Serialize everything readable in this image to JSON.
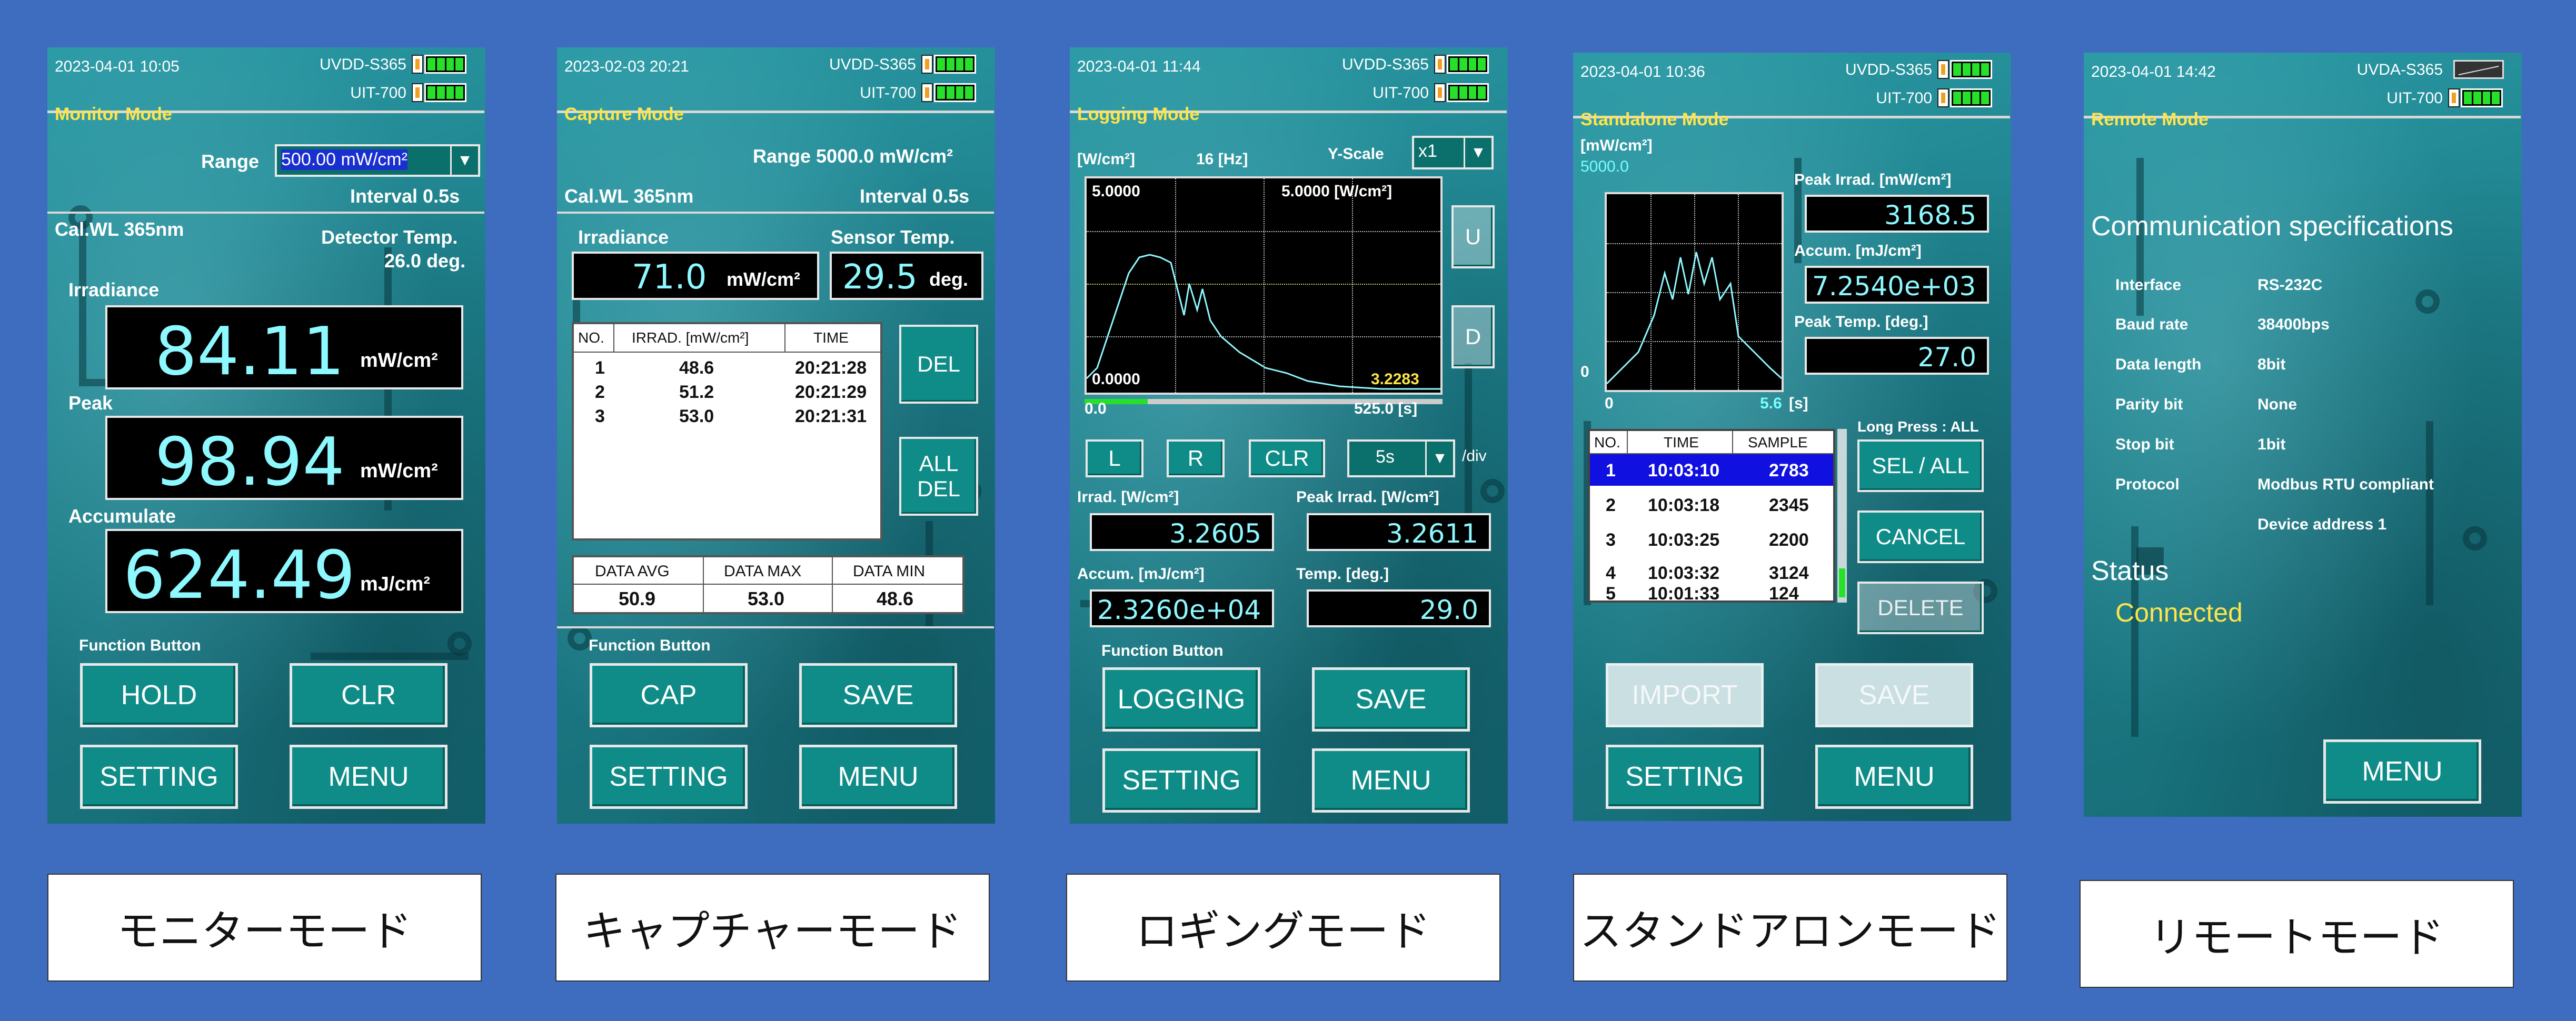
{
  "screens": {
    "monitor": {
      "date": "2023-04-01  10:05",
      "dev1": "UVDD-S365",
      "dev2": "UIT-700",
      "mode": "Monitor Mode",
      "range_label": "Range",
      "range_value": "500.00 mW/cm²",
      "interval": "Interval  0.5s",
      "calwl": "Cal.WL 365nm",
      "detector_temp_label": "Detector Temp.",
      "detector_temp_value": "26.0 deg.",
      "irradiance_label": "Irradiance",
      "irradiance_value": "84.11",
      "irradiance_unit": "mW/cm²",
      "peak_label": "Peak",
      "peak_value": "98.94",
      "peak_unit": "mW/cm²",
      "accum_label": "Accumulate",
      "accum_value": "624.49",
      "accum_unit": "mJ/cm²",
      "func_label": "Function Button",
      "btn_hold": "HOLD",
      "btn_clr": "CLR",
      "btn_setting": "SETTING",
      "btn_menu": "MENU",
      "caption": "モニターモード"
    },
    "capture": {
      "date": "2023-02-03  20:21",
      "dev1": "UVDD-S365",
      "dev2": "UIT-700",
      "mode": "Capture Mode",
      "range": "Range  5000.0 mW/cm²",
      "calwl": "Cal.WL 365nm",
      "interval": "Interval  0.5s",
      "irr_label": "Irradiance",
      "irr_value": "71.0",
      "irr_unit": "mW/cm²",
      "st_label": "Sensor Temp.",
      "st_value": "29.5",
      "st_unit": "deg.",
      "table_headers": [
        "NO.",
        "IRRAD. [mW/cm²]",
        "TIME"
      ],
      "rows": [
        [
          "1",
          "48.6",
          "20:21:28"
        ],
        [
          "2",
          "51.2",
          "20:21:29"
        ],
        [
          "3",
          "53.0",
          "20:21:31"
        ]
      ],
      "btn_del": "DEL",
      "btn_alldel_1": "ALL",
      "btn_alldel_2": "DEL",
      "stats_headers": [
        "DATA AVG",
        "DATA MAX",
        "DATA MIN"
      ],
      "stats_values": [
        "50.9",
        "53.0",
        "48.6"
      ],
      "func_label": "Function Button",
      "btn_cap": "CAP",
      "btn_save": "SAVE",
      "btn_setting": "SETTING",
      "btn_menu": "MENU",
      "caption": "キャプチャーモード"
    },
    "logging": {
      "date": "2023-04-01  11:44",
      "dev1": "UVDD-S365",
      "dev2": "UIT-700",
      "mode": "Logging Mode",
      "unit_label": "[W/cm²]",
      "hz": "16 [Hz]",
      "yscale_label": "Y-Scale",
      "yscale_value": "x1",
      "graph_ymax_left": "5.0000",
      "graph_ymax_right": "5.0000 [W/cm²]",
      "graph_ymin": "0.0000",
      "graph_cur": "3.2283",
      "x_start": "0.0",
      "x_end": "525.0 [s]",
      "btn_u": "U",
      "btn_d": "D",
      "btn_l": "L",
      "btn_r": "R",
      "btn_clr": "CLR",
      "div_value": "5s",
      "div_label": "/div",
      "irrad_label": "Irrad. [W/cm²]",
      "irrad_value": "3.2605",
      "peak_label": "Peak Irrad. [W/cm²]",
      "peak_value": "3.2611",
      "accum_label": "Accum. [mJ/cm²]",
      "accum_value": "2.3260e+04",
      "temp_label": "Temp. [deg.]",
      "temp_value": "29.0",
      "func_label": "Function Button",
      "btn_logging": "LOGGING",
      "btn_save": "SAVE",
      "btn_setting": "SETTING",
      "btn_menu": "MENU",
      "caption": "ロギングモード"
    },
    "standalone": {
      "date": "2023-04-01  10:36",
      "dev1": "UVDD-S365",
      "dev2": "UIT-700",
      "mode": "Standalone Mode",
      "unit_label": "[mW/cm²]",
      "ymax": "5000.0",
      "ymin": "0",
      "x_start": "0",
      "x_end": "5.6",
      "x_unit": "[s]",
      "peak_label": "Peak Irrad. [mW/cm²]",
      "peak_value": "3168.5",
      "accum_label": "Accum. [mJ/cm²]",
      "accum_value": "7.2540e+03",
      "temp_label": "Peak Temp. [deg.]",
      "temp_value": "27.0",
      "table_headers": [
        "NO.",
        "TIME",
        "SAMPLE"
      ],
      "rows": [
        [
          "1",
          "10:03:10",
          "2783"
        ],
        [
          "2",
          "10:03:18",
          "2345"
        ],
        [
          "3",
          "10:03:25",
          "2200"
        ],
        [
          "4",
          "10:03:32",
          "3124"
        ],
        [
          "5",
          "10:01:33",
          "124"
        ]
      ],
      "long_press": "Long Press : ALL",
      "btn_sel": "SEL / ALL",
      "btn_cancel": "CANCEL",
      "btn_delete": "DELETE",
      "btn_import": "IMPORT",
      "btn_save": "SAVE",
      "btn_setting": "SETTING",
      "btn_menu": "MENU",
      "caption": "スタンドアロンモード"
    },
    "remote": {
      "date": "2023-04-01  14:42",
      "dev1": "UVDA-S365",
      "dev2": "UIT-700",
      "mode": "Remote Mode",
      "comm_title": "Communication specifications",
      "specs": [
        [
          "Interface",
          "RS-232C"
        ],
        [
          "Baud rate",
          "38400bps"
        ],
        [
          "Data length",
          "8bit"
        ],
        [
          "Parity bit",
          "None"
        ],
        [
          "Stop bit",
          "1bit"
        ],
        [
          "Protocol",
          "Modbus RTU compliant"
        ],
        [
          "",
          "Device address 1"
        ]
      ],
      "status_label": "Status",
      "status_value": "Connected",
      "btn_menu": "MENU",
      "caption": "リモートモード"
    }
  },
  "colors": {
    "page_bg": "#3e6cbf",
    "screen_teal": "#1d7f8a",
    "mode_label": "#ffe44a",
    "value_cyan": "#8ef8ff",
    "button_teal": "#0f8c88",
    "selection_blue": "#1010e0",
    "battery_green": "#27e02a"
  },
  "icons": [
    "battery-icon",
    "plug-icon",
    "dropdown-arrow-icon"
  ]
}
